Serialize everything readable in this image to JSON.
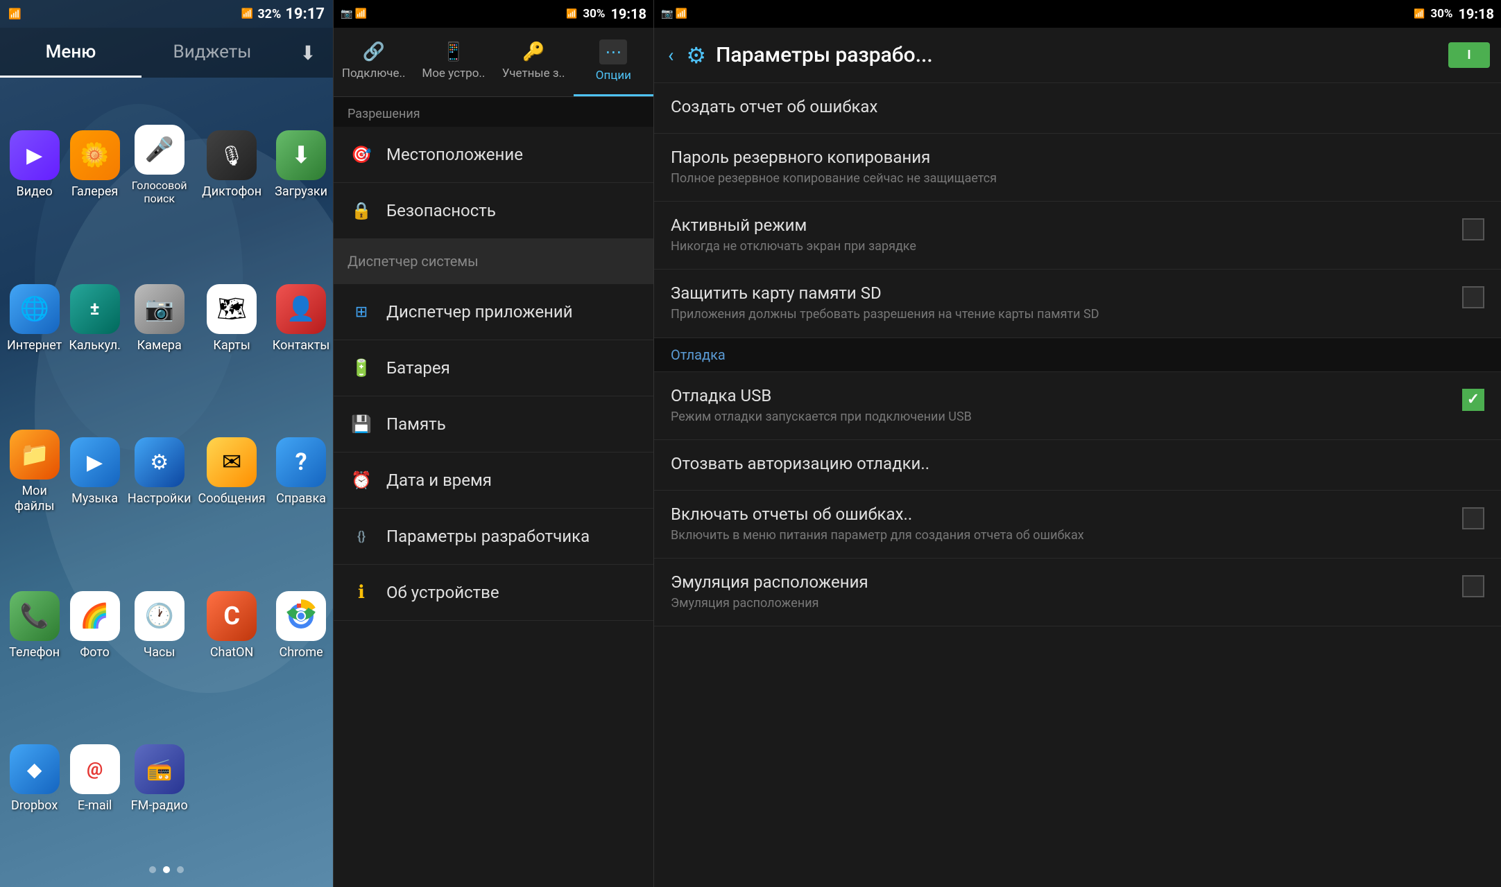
{
  "homeScreen": {
    "statusBar": {
      "wifiIcon": "📶",
      "signalIcon": "📶",
      "batteryPercent": "32%",
      "time": "19:17"
    },
    "tabs": [
      {
        "label": "Меню",
        "active": true
      },
      {
        "label": "Виджеты",
        "active": false
      }
    ],
    "downloadIcon": "⬇",
    "apps": [
      {
        "id": "video",
        "label": "Видео",
        "icon": "▶",
        "iconClass": "icon-video"
      },
      {
        "id": "gallery",
        "label": "Галерея",
        "icon": "🌼",
        "iconClass": "icon-gallery"
      },
      {
        "id": "voice",
        "label": "Голосовой поиск",
        "icon": "🎤",
        "iconClass": "icon-voice"
      },
      {
        "id": "dictaphone",
        "label": "Диктофон",
        "icon": "🎙",
        "iconClass": "icon-dictaphone"
      },
      {
        "id": "download",
        "label": "Загрузки",
        "icon": "⬇",
        "iconClass": "icon-download"
      },
      {
        "id": "internet",
        "label": "Интернет",
        "icon": "🌐",
        "iconClass": "icon-internet"
      },
      {
        "id": "calc",
        "label": "Калькул.",
        "icon": "±",
        "iconClass": "icon-calc"
      },
      {
        "id": "camera",
        "label": "Камера",
        "icon": "📷",
        "iconClass": "icon-camera"
      },
      {
        "id": "maps",
        "label": "Карты",
        "icon": "🗺",
        "iconClass": "icon-maps"
      },
      {
        "id": "contacts",
        "label": "Контакты",
        "icon": "👤",
        "iconClass": "icon-contacts"
      },
      {
        "id": "myfiles",
        "label": "Мои файлы",
        "icon": "📁",
        "iconClass": "icon-myfiles"
      },
      {
        "id": "music",
        "label": "Музыка",
        "icon": "▶",
        "iconClass": "icon-music"
      },
      {
        "id": "settings",
        "label": "Настройки",
        "icon": "⚙",
        "iconClass": "icon-settings"
      },
      {
        "id": "messages",
        "label": "Сообщения",
        "icon": "✉",
        "iconClass": "icon-messages"
      },
      {
        "id": "help",
        "label": "Справка",
        "icon": "?",
        "iconClass": "icon-help"
      },
      {
        "id": "phone",
        "label": "Телефон",
        "icon": "📞",
        "iconClass": "icon-phone"
      },
      {
        "id": "photos",
        "label": "Фото",
        "icon": "🌈",
        "iconClass": "icon-photos"
      },
      {
        "id": "clock",
        "label": "Часы",
        "icon": "🕐",
        "iconClass": "icon-clock"
      },
      {
        "id": "chaton",
        "label": "ChatON",
        "icon": "C",
        "iconClass": "icon-chaton"
      },
      {
        "id": "chrome",
        "label": "Chrome",
        "icon": "◎",
        "iconClass": "icon-chrome"
      },
      {
        "id": "dropbox",
        "label": "Dropbox",
        "icon": "◆",
        "iconClass": "icon-dropbox"
      },
      {
        "id": "email",
        "label": "E-mail",
        "icon": "@",
        "iconClass": "icon-email"
      },
      {
        "id": "fmradio",
        "label": "FM-радио",
        "icon": "📻",
        "iconClass": "icon-fmradio"
      }
    ],
    "pageDots": [
      {
        "active": false
      },
      {
        "active": true
      },
      {
        "active": false
      }
    ]
  },
  "settingsPanel": {
    "statusBar": {
      "time": "19:18",
      "batteryPercent": "30%"
    },
    "tabs": [
      {
        "label": "Подключе..",
        "icon": "🔗",
        "active": false
      },
      {
        "label": "Мое устро..",
        "icon": "📱",
        "active": false
      },
      {
        "label": "Учетные з..",
        "icon": "🔑",
        "active": false
      },
      {
        "label": "Опции",
        "icon": "⋯",
        "active": true
      }
    ],
    "sectionHeader": "Разрешения",
    "items": [
      {
        "label": "Местоположение",
        "icon": "🎯",
        "iconColor": "#4caf50",
        "highlighted": false
      },
      {
        "label": "Безопасность",
        "icon": "🔒",
        "iconColor": "#42a5f5",
        "highlighted": false
      },
      {
        "label": "Диспетчер системы",
        "icon": "",
        "iconColor": "",
        "isSection": true,
        "highlighted": true
      },
      {
        "label": "Диспетчер приложений",
        "icon": "⊞",
        "iconColor": "#42a5f5",
        "highlighted": false
      },
      {
        "label": "Батарея",
        "icon": "🔋",
        "iconColor": "#4caf50",
        "highlighted": false
      },
      {
        "label": "Память",
        "icon": "💾",
        "iconColor": "#78909c",
        "highlighted": false
      },
      {
        "label": "Дата и время",
        "icon": "⏰",
        "iconColor": "#78909c",
        "highlighted": false
      },
      {
        "label": "Параметры разработчика",
        "icon": "{}",
        "iconColor": "#78909c",
        "highlighted": false
      },
      {
        "label": "Об устройстве",
        "icon": "ℹ",
        "iconColor": "#ffc107",
        "highlighted": false
      }
    ]
  },
  "devOptionsPanel": {
    "statusBar": {
      "time": "19:18",
      "batteryPercent": "30%"
    },
    "header": {
      "backLabel": "‹",
      "gearIcon": "⚙",
      "title": "Параметры разрабо...",
      "toggleLabel": "I"
    },
    "options": [
      {
        "type": "option",
        "title": "Создать отчет об ошибках",
        "subtitle": "",
        "hasCheckbox": false
      },
      {
        "type": "option",
        "title": "Пароль резервного копирования",
        "subtitle": "Полное резервное копирование сейчас не защищается",
        "hasCheckbox": false
      },
      {
        "type": "option",
        "title": "Активный режим",
        "subtitle": "Никогда не отключать экран при зарядке",
        "hasCheckbox": true,
        "checked": false
      },
      {
        "type": "option",
        "title": "Защитить карту памяти SD",
        "subtitle": "Приложения должны требовать разрешения на чтение карты памяти SD",
        "hasCheckbox": true,
        "checked": false
      },
      {
        "type": "section",
        "title": "Отладка"
      },
      {
        "type": "option",
        "title": "Отладка USB",
        "subtitle": "Режим отладки запускается при подключении USB",
        "hasCheckbox": true,
        "checked": true
      },
      {
        "type": "option",
        "title": "Отозвать авторизацию отладки..",
        "subtitle": "",
        "hasCheckbox": false
      },
      {
        "type": "option",
        "title": "Включать отчеты об ошибках..",
        "subtitle": "Включить в меню питания параметр для создания отчета об ошибках",
        "hasCheckbox": true,
        "checked": false
      },
      {
        "type": "option",
        "title": "Эмуляция расположения",
        "subtitle": "Эмуляция расположения",
        "hasCheckbox": true,
        "checked": false
      }
    ]
  }
}
